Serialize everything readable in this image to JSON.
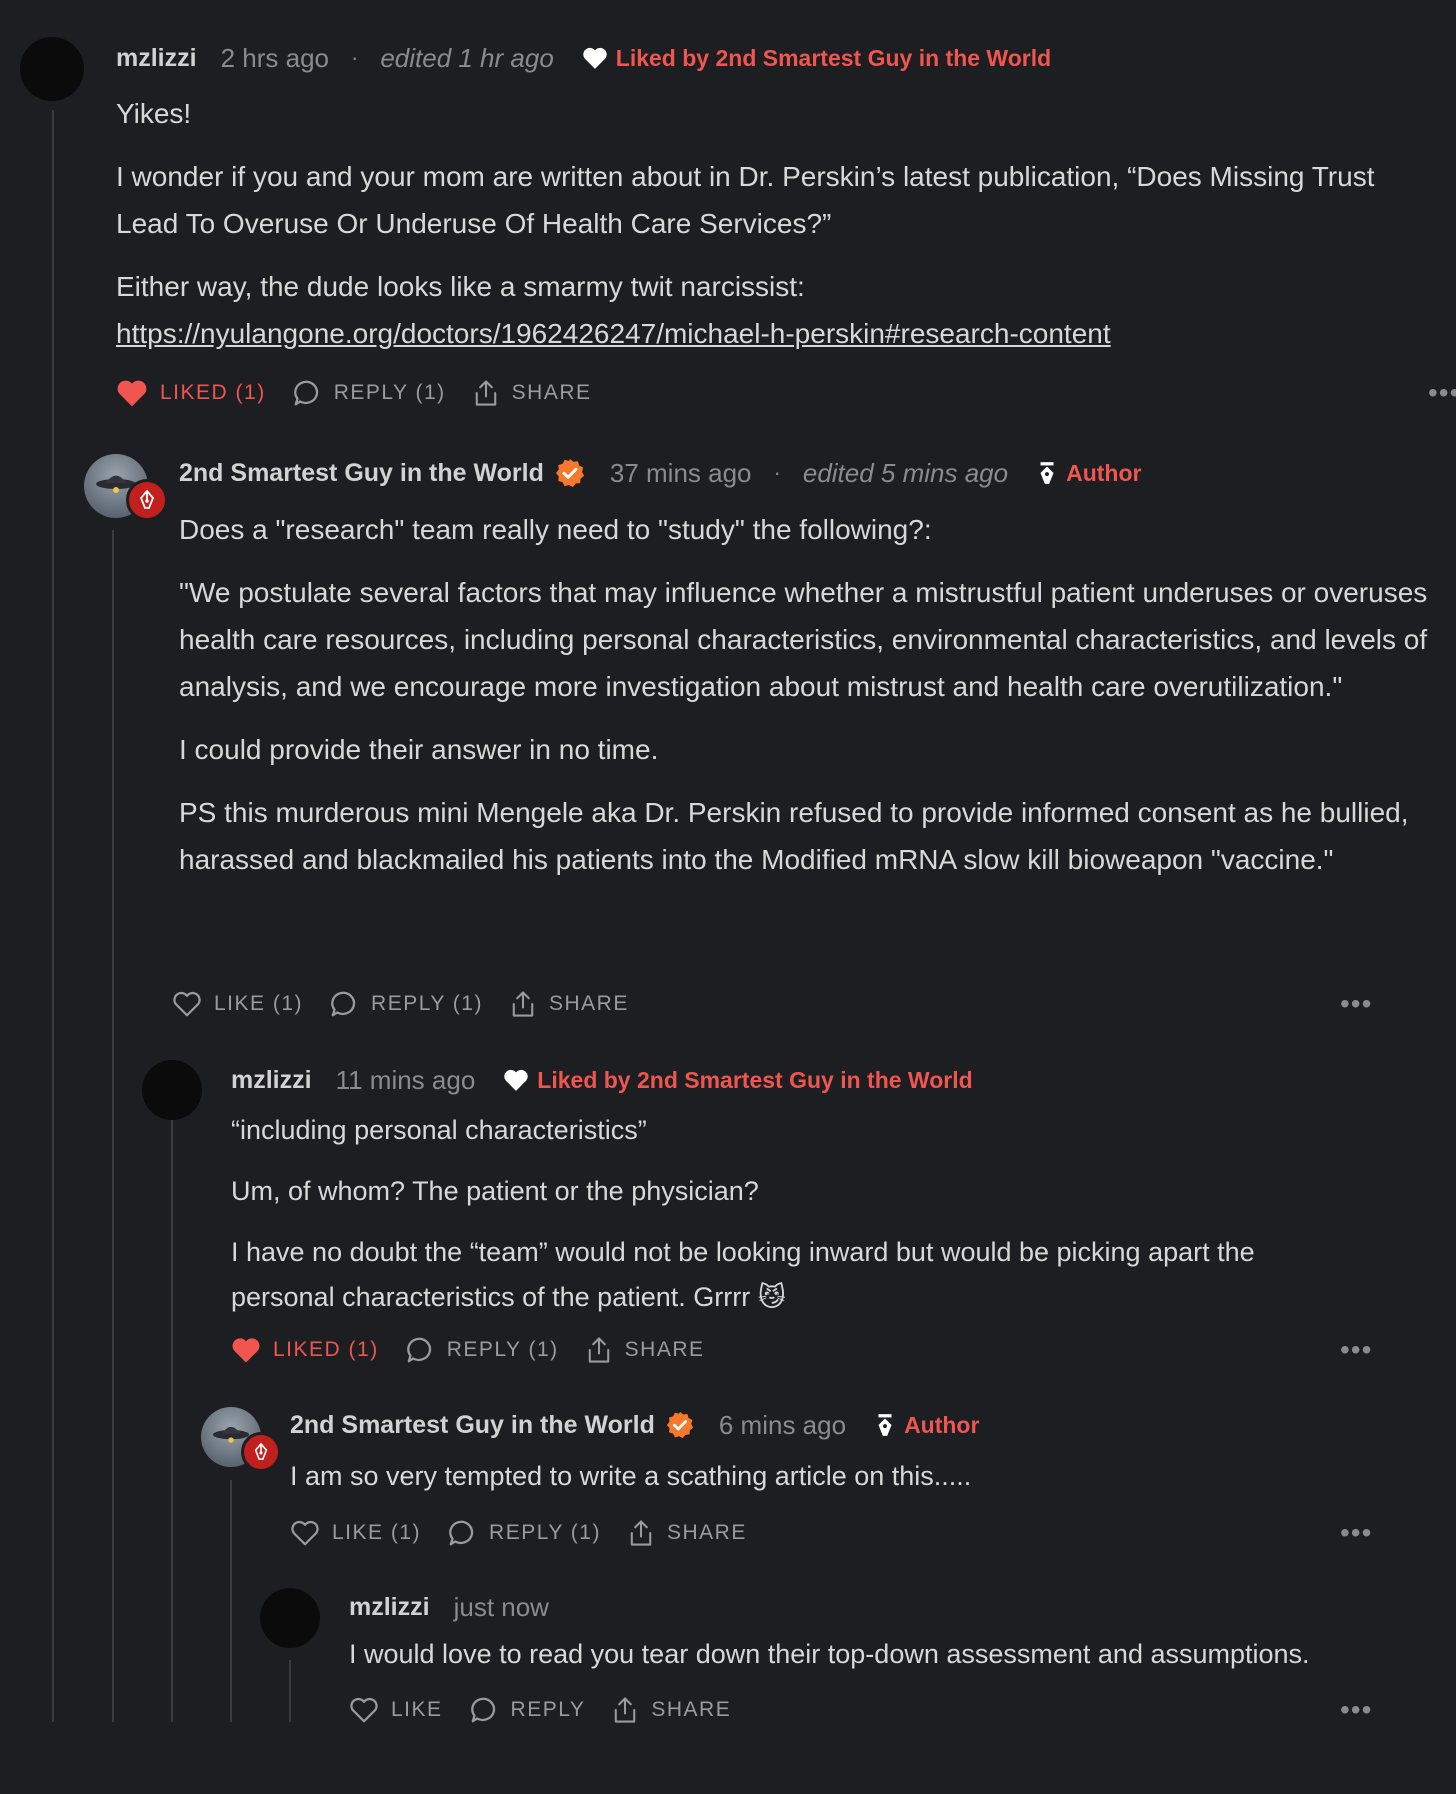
{
  "comments": [
    {
      "name": "mzlizzi",
      "time": "2 hrs ago",
      "edited": "edited 1 hr ago",
      "liked_by": "Liked by 2nd Smartest Guy in the World",
      "paragraphs": [
        "Yikes!",
        "I wonder if you and your mom are written about in Dr. Perskin’s latest publication, “Does Missing Trust Lead To Overuse Or Underuse Of Health Care Services?”",
        "Either way, the dude looks like a smarmy twit narcissist:"
      ],
      "link": "https://nyulangone.org/doctors/1962426247/michael-h-perskin#research-content",
      "like_label": "LIKED (1)",
      "reply_label": "REPLY (1)",
      "share_label": "SHARE",
      "liked": true
    },
    {
      "name": "2nd Smartest Guy in the World",
      "time": "37 mins ago",
      "edited": "edited 5 mins ago",
      "author_label": "Author",
      "paragraphs": [
        "Does a \"research\" team really need to \"study\" the following?:",
        "\"We postulate several factors that may influence whether a mistrustful patient underuses or overuses health care resources, including personal characteristics, environmental characteristics, and levels of analysis, and we encourage more investigation about mistrust and health care overutilization.\"",
        "I could provide their answer in no time.",
        "PS this murderous mini Mengele aka Dr. Perskin refused to provide informed consent as he bullied, harassed and blackmailed his patients into the Modified mRNA slow kill bioweapon \"vaccine.\""
      ],
      "like_label": "LIKE (1)",
      "reply_label": "REPLY (1)",
      "share_label": "SHARE",
      "liked": false
    },
    {
      "name": "mzlizzi",
      "time": "11 mins ago",
      "liked_by": "Liked by 2nd Smartest Guy in the World",
      "paragraphs": [
        "“including personal characteristics”",
        "Um, of whom? The patient or the physician?",
        "I have no doubt the “team” would not be looking inward but would be picking apart the personal characteristics of the patient. Grrrr 😼"
      ],
      "like_label": "LIKED (1)",
      "reply_label": "REPLY (1)",
      "share_label": "SHARE",
      "liked": true
    },
    {
      "name": "2nd Smartest Guy in the World",
      "time": "6 mins ago",
      "author_label": "Author",
      "paragraphs": [
        "I am so very tempted to write a scathing article on this....."
      ],
      "like_label": "LIKE (1)",
      "reply_label": "REPLY (1)",
      "share_label": "SHARE",
      "liked": false
    },
    {
      "name": "mzlizzi",
      "time": "just now",
      "paragraphs": [
        "I would love to read you tear down their top-down assessment and assumptions."
      ],
      "like_label": "LIKE",
      "reply_label": "REPLY",
      "share_label": "SHARE",
      "liked": false
    }
  ],
  "more_label": "•••",
  "colors": {
    "background": "#1d1e21",
    "accent_red": "#f0554f",
    "verified_orange": "#f5782d",
    "muted": "#8a8b8e"
  },
  "icons": [
    "heart-icon",
    "comment-bubble-icon",
    "share-icon",
    "pen-nib-icon",
    "verified-check-icon",
    "more-options-icon"
  ]
}
